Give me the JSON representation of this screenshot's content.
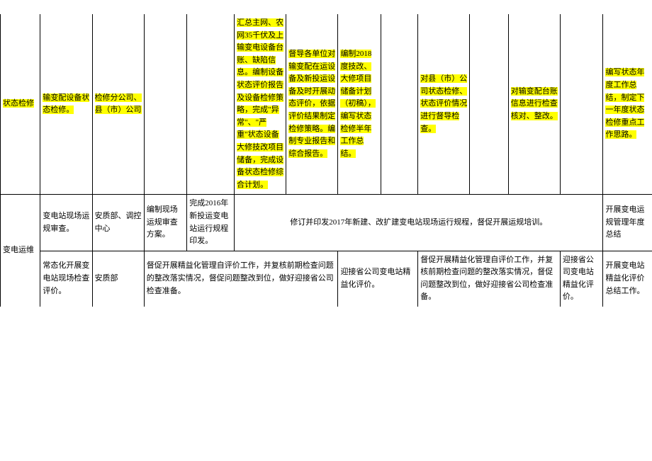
{
  "row1": {
    "c1": "状态检修",
    "c2": "输变配设备状态检修。",
    "c3": "检修分公司、县（市）公司",
    "c6": "汇总主网、农网35千伏及上输变电设备台账、缺陷信息。编制设备状态评价报告及设备检修策略，完成\"异常\"、\"严重\"状态设备大修技改项目储备，完成设备状态检修综合计划。",
    "c7": "督导各单位对输变配在运设备及新投运设备及时开展动态评价，依据评价结果制定检修策略。编制专业报告和综合报告。",
    "c8": "编制2018度技改、大修项目储备计划（初稿），编写状态检修半年工作总结。",
    "c10": "对县（市）公司状态检修、状态评价情况进行督导检查。",
    "c12": "对输变配台账信息进行检查核对、整改。",
    "c14": "编写状态年度工作总结，制定下一年度状态检修重点工作思路。"
  },
  "row2": {
    "c1": "变电运维",
    "c2": "变电站现场运规审查。",
    "c3": "安质部、调控中心",
    "c4": "编制现场运规审查方案。",
    "c5": "完成2016年新投运变电站运行规程印发。",
    "c6to13": "修订并印发2017年新建、改扩建变电站现场运行规程，督促开展运规培训。",
    "c14": "开展变电运规管理年度总结"
  },
  "row3": {
    "c2": "常态化开展变电站现场检查评价。",
    "c3": "安质部",
    "c4to7": "督促开展精益化管理自评价工作，并复核前期检查问题的整改落实情况，督促问题整改到位，做好迎接省公司检查准备。",
    "c8to9": "迎接省公司变电站精益化评价。",
    "c10to12": "督促开展精益化管理自评价工作，并复核前期检查问题的整改落实情况，督促问题整改到位，做好迎接省公司检查准备。",
    "c13": "迎接省公司变电站精益化评价。",
    "c14": "开展变电站精益化评价总结工作。"
  }
}
